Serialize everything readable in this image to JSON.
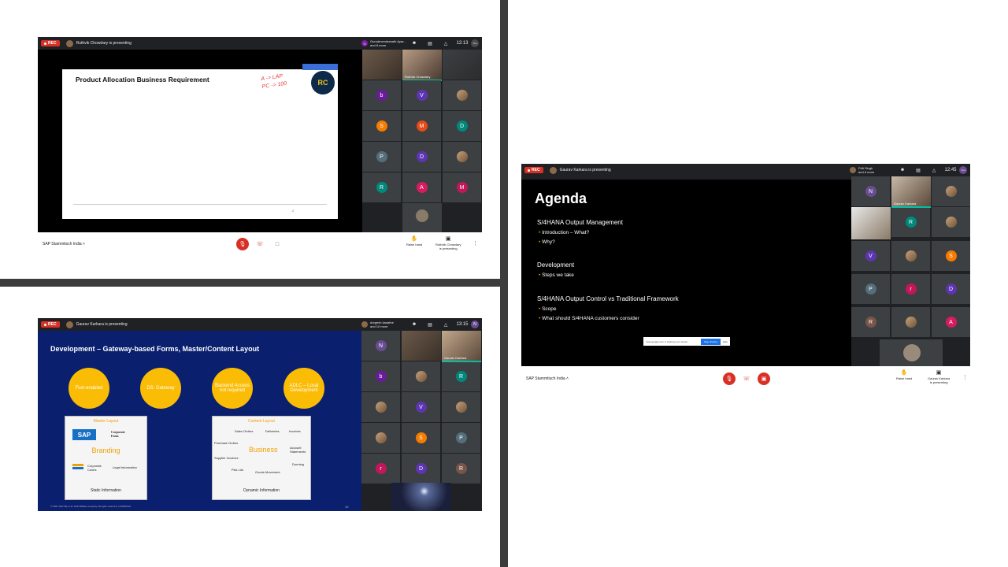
{
  "meet1": {
    "presenter": "Ruthvik Chowdary is presenting",
    "participants": [
      "Gurudevendranath Ayar...",
      "and 8 more"
    ],
    "participant_initial": "G",
    "time": "12:13",
    "you": "You",
    "meeting_name": "SAP Stammtisch India",
    "raise_hand": "Raise hand",
    "presenter_btn": [
      "Ruthvik Chowdary",
      "is presenting"
    ],
    "slide_title": "Product Allocation Business Requirement",
    "annotation": [
      "A -> LAP",
      "PC -> 100"
    ],
    "logo": "RC",
    "page_num": "2",
    "video_label": "Ruthvik Chowdary",
    "tiles": [
      {
        "t": "b",
        "c": "#6a1b9a"
      },
      {
        "t": "V",
        "c": "#5e35b1"
      },
      {
        "t": "",
        "c": "photo"
      },
      {
        "t": "S",
        "c": "#f57c00"
      },
      {
        "t": "M",
        "c": "#e64a19"
      },
      {
        "t": "D",
        "c": "#00897b"
      },
      {
        "t": "P",
        "c": "#546e7a"
      },
      {
        "t": "D",
        "c": "#5e35b1"
      },
      {
        "t": "",
        "c": "photo"
      },
      {
        "t": "R",
        "c": "#00897b"
      },
      {
        "t": "A",
        "c": "#d81b60"
      },
      {
        "t": "M",
        "c": "#c2185b"
      }
    ]
  },
  "meet2": {
    "presenter": "Gaurav Karkara is presenting",
    "participants": [
      "durgesh kanathe",
      "and 10 more"
    ],
    "time": "13:15",
    "you": "N",
    "slide_title": "Development – Gateway-based Forms, Master/Content Layout",
    "circles": [
      "Fiori-enabled",
      "DS: Gateway",
      "Backend Access not required",
      "ADLC – Local Development"
    ],
    "master_title": "Master Layout",
    "sap": "SAP",
    "corporate_fonts": [
      "Corporate",
      "Fonts"
    ],
    "branding": "Branding",
    "corporate_colors": [
      "Corporate",
      "Colors"
    ],
    "legal": "Legal Information",
    "static": "Static Information",
    "content_title": "Content Layout",
    "content_items": [
      "Sales Orders",
      "Deliveries",
      "Invoices",
      "Purchase Orders",
      "Account Statements",
      "Supplier Invoices",
      "Dunning",
      "Pick List",
      "Goods Movement"
    ],
    "business": "Business",
    "dynamic": "Dynamic Information",
    "footer": "© 2021 SAP SE or an SAP affiliate company. All rights reserved. | INTERNAL",
    "page_num": "10",
    "video_label": "Gaurav Karkara",
    "tiles": [
      {
        "t": "N",
        "c": "#6a4c93"
      },
      {
        "t": "b",
        "c": "#6a1b9a"
      },
      {
        "t": "",
        "c": "photo"
      },
      {
        "t": "R",
        "c": "#00897b"
      },
      {
        "t": "",
        "c": "photo"
      },
      {
        "t": "V",
        "c": "#5e35b1"
      },
      {
        "t": "",
        "c": "photo"
      },
      {
        "t": "",
        "c": "photo"
      },
      {
        "t": "S",
        "c": "#f57c00"
      },
      {
        "t": "P",
        "c": "#546e7a"
      },
      {
        "t": "r",
        "c": "#c2185b"
      },
      {
        "t": "D",
        "c": "#5e35b1"
      },
      {
        "t": "R",
        "c": "#795548"
      }
    ]
  },
  "meet3": {
    "presenter": "Gaurav Karkara is presenting",
    "participants": [
      "Priti Singh",
      "and 6 more"
    ],
    "time": "12:45",
    "you": "You",
    "meeting_name": "SAP Stammtisch India",
    "raise_hand": "Raise hand",
    "presenter_btn": [
      "Gaurav Karkara",
      "is presenting"
    ],
    "agenda_title": "Agenda",
    "sections": [
      {
        "head": "S/4HANA Output Management",
        "items": [
          "Introduction – What?",
          "Why?"
        ]
      },
      {
        "head": "Development",
        "items": [
          "Steps we take"
        ]
      },
      {
        "head": "S/4HANA Output Control vs Traditional Framework",
        "items": [
          "Scope",
          "What should S/4HANA customers consider"
        ]
      }
    ],
    "share_msg": "meet.google.com is sharing your screen.",
    "stop_sharing": "Stop sharing",
    "hide": "Hide",
    "video_label": "Gaurav Karkara",
    "tiles": [
      {
        "t": "N",
        "c": "#6a4c93"
      },
      {
        "t": "",
        "c": "photo"
      },
      {
        "t": "R",
        "c": "#00897b"
      },
      {
        "t": "",
        "c": "photo"
      },
      {
        "t": "V",
        "c": "#5e35b1"
      },
      {
        "t": "",
        "c": "photo"
      },
      {
        "t": "S",
        "c": "#f57c00"
      },
      {
        "t": "P",
        "c": "#546e7a"
      },
      {
        "t": "r",
        "c": "#c2185b"
      },
      {
        "t": "D",
        "c": "#5e35b1"
      },
      {
        "t": "R",
        "c": "#795548"
      },
      {
        "t": "",
        "c": "photo"
      },
      {
        "t": "A",
        "c": "#d81b60"
      }
    ]
  }
}
